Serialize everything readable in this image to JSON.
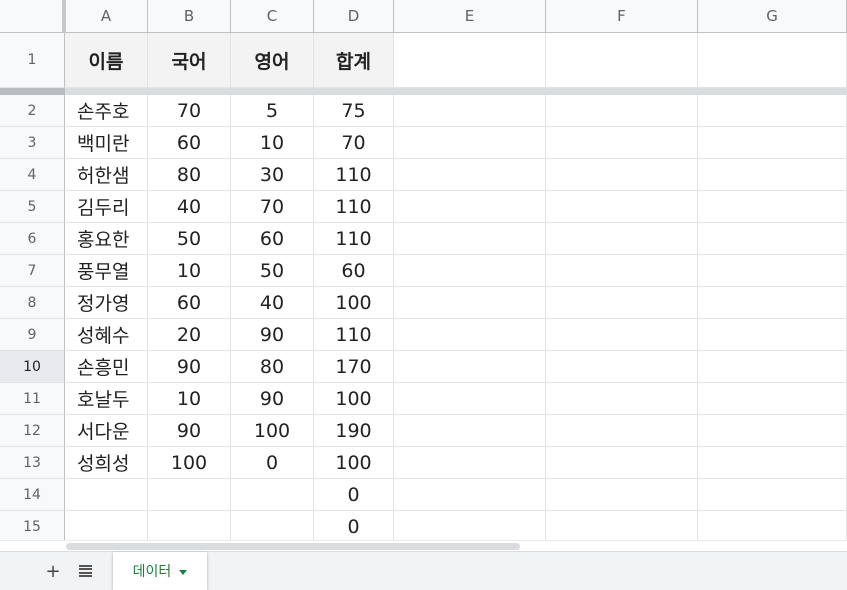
{
  "columns": [
    "A",
    "B",
    "C",
    "D",
    "E",
    "F",
    "G"
  ],
  "rows": [
    {
      "n": "1",
      "a": "이름",
      "b": "국어",
      "c": "영어",
      "d": "합계"
    },
    {
      "n": "2",
      "a": "손주호",
      "b": "70",
      "c": "5",
      "d": "75"
    },
    {
      "n": "3",
      "a": "백미란",
      "b": "60",
      "c": "10",
      "d": "70"
    },
    {
      "n": "4",
      "a": "허한샘",
      "b": "80",
      "c": "30",
      "d": "110"
    },
    {
      "n": "5",
      "a": "김두리",
      "b": "40",
      "c": "70",
      "d": "110"
    },
    {
      "n": "6",
      "a": "홍요한",
      "b": "50",
      "c": "60",
      "d": "110"
    },
    {
      "n": "7",
      "a": "풍무열",
      "b": "10",
      "c": "50",
      "d": "60"
    },
    {
      "n": "8",
      "a": "정가영",
      "b": "60",
      "c": "40",
      "d": "100"
    },
    {
      "n": "9",
      "a": "성혜수",
      "b": "20",
      "c": "90",
      "d": "110"
    },
    {
      "n": "10",
      "a": "손흥민",
      "b": "90",
      "c": "80",
      "d": "170"
    },
    {
      "n": "11",
      "a": "호날두",
      "b": "10",
      "c": "90",
      "d": "100"
    },
    {
      "n": "12",
      "a": "서다운",
      "b": "90",
      "c": "100",
      "d": "190"
    },
    {
      "n": "13",
      "a": "성희성",
      "b": "100",
      "c": "0",
      "d": "100"
    },
    {
      "n": "14",
      "a": "",
      "b": "",
      "c": "",
      "d": "0"
    },
    {
      "n": "15",
      "a": "",
      "b": "",
      "c": "",
      "d": "0"
    }
  ],
  "selected_row": "10",
  "sheet_tab": {
    "label": "데이터"
  },
  "icons": {
    "add": "plus-icon",
    "all_sheets": "menu-lines-icon",
    "tab_menu": "caret-down-icon"
  },
  "colors": {
    "tab_text": "#188038",
    "header_fill": "#f3f3f3"
  }
}
